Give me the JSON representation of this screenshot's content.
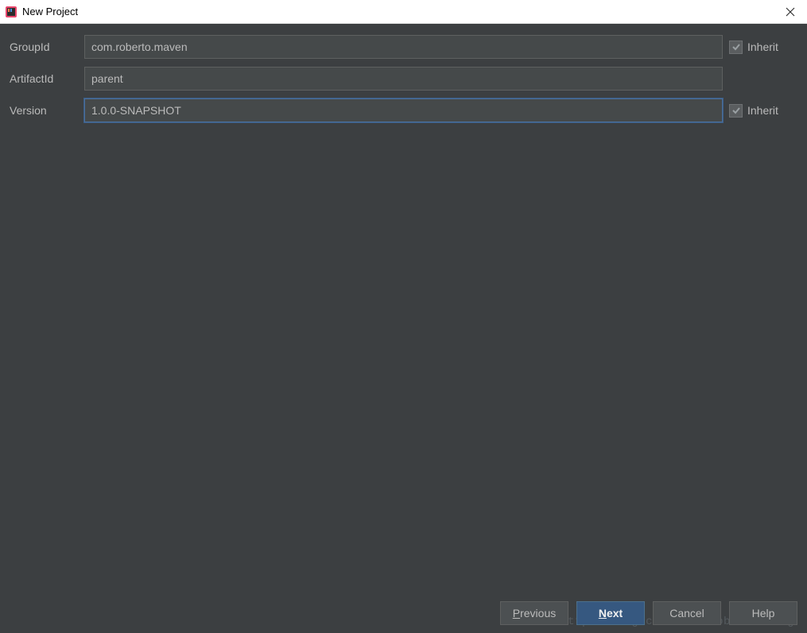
{
  "titlebar": {
    "title": "New Project"
  },
  "form": {
    "groupId": {
      "label": "GroupId",
      "value": "com.roberto.maven",
      "inheritLabel": "Inherit"
    },
    "artifactId": {
      "label": "ArtifactId",
      "value": "parent"
    },
    "version": {
      "label": "Version",
      "value": "1.0.0-SNAPSHOT",
      "inheritLabel": "Inherit"
    }
  },
  "buttons": {
    "previous": "Previous",
    "next": "Next",
    "cancel": "Cancel",
    "help": "Help"
  },
  "watermark": "http://blog.csdn.net/RobertoHuang"
}
